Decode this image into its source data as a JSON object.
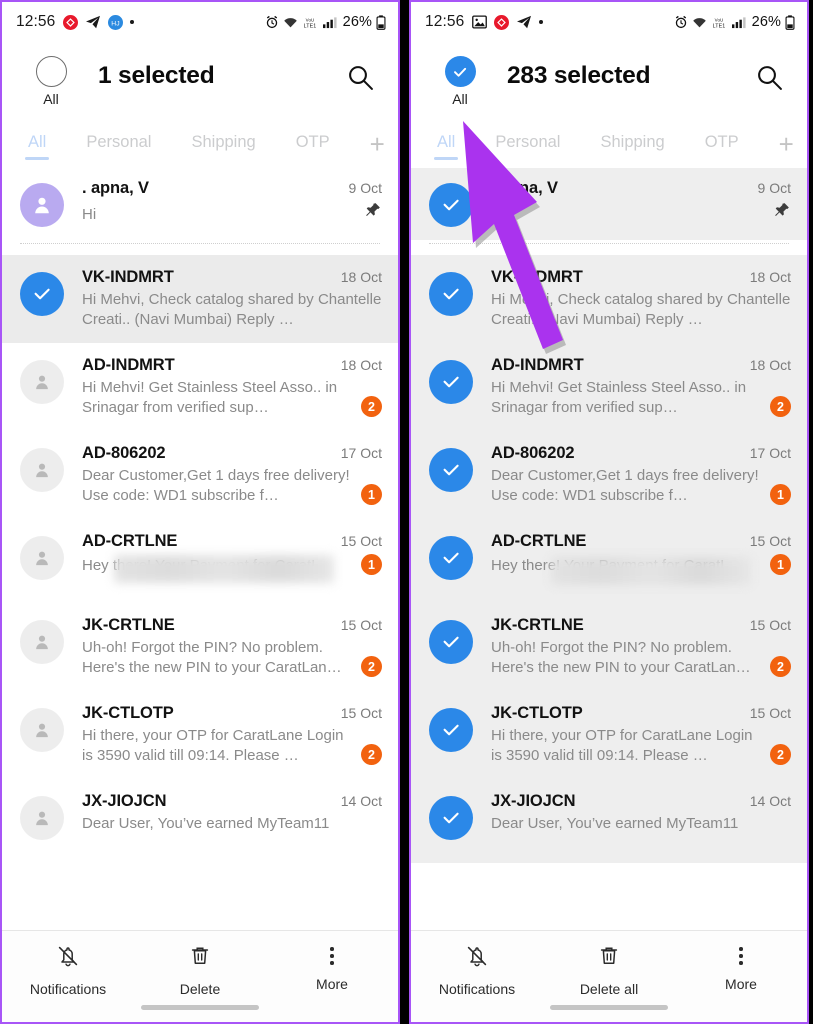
{
  "statusbar": {
    "time": "12:56",
    "battery_percent": "26%",
    "network_label": "LTE1",
    "voice_label": "VoLTE",
    "left_icons_panel1": [
      "telegram-icon",
      "blue-app-icon",
      "dot-icon"
    ],
    "left_icons_panel2": [
      "image-icon",
      "telegram-icon",
      "dot-icon"
    ],
    "right_icons": [
      "alarm-icon",
      "wifi-icon",
      "volte-icon",
      "signal-icon",
      "battery-icon"
    ]
  },
  "panels": [
    {
      "id": "before",
      "header": {
        "all_label": "All",
        "all_checked": false,
        "selected_text": "1 selected",
        "search_icon": "search-icon"
      },
      "tabs": [
        {
          "label": "All",
          "active": true
        },
        {
          "label": "Personal",
          "active": false
        },
        {
          "label": "Shipping",
          "active": false
        },
        {
          "label": "OTP",
          "active": false
        }
      ],
      "tab_add_label": "+",
      "bottombar": [
        {
          "label": "Notifications",
          "icon": "bell-off-icon"
        },
        {
          "label": "Delete",
          "icon": "trash-icon"
        },
        {
          "label": "More",
          "icon": "overflow-menu-icon"
        }
      ]
    },
    {
      "id": "after",
      "header": {
        "all_label": "All",
        "all_checked": true,
        "selected_text": "283 selected",
        "search_icon": "search-icon"
      },
      "tabs": [
        {
          "label": "All",
          "active": true
        },
        {
          "label": "Personal",
          "active": false
        },
        {
          "label": "Shipping",
          "active": false
        },
        {
          "label": "OTP",
          "active": false
        }
      ],
      "tab_add_label": "+",
      "bottombar": [
        {
          "label": "Notifications",
          "icon": "bell-off-icon"
        },
        {
          "label": "Delete all",
          "icon": "trash-icon"
        },
        {
          "label": "More",
          "icon": "overflow-menu-icon"
        }
      ]
    }
  ],
  "messages": [
    {
      "sender": ". apna, V",
      "date": "9 Oct",
      "snippet": "Hi",
      "badge": "",
      "pinned": true,
      "avatar": "purple",
      "selected_left": false,
      "selected_right": true,
      "highlight_left": false
    },
    {
      "sender": "VK-INDMRT",
      "date": "18 Oct",
      "snippet": "Hi Mehvi, Check catalog shared by Chantelle Creati.. (Navi Mumbai)  Reply …",
      "badge": "",
      "pinned": false,
      "avatar": "gray",
      "selected_left": true,
      "selected_right": true,
      "highlight_left": true
    },
    {
      "sender": "AD-INDMRT",
      "date": "18 Oct",
      "snippet": "Hi Mehvi! Get Stainless Steel Asso.. in Srinagar from verified sup…",
      "badge": "2",
      "pinned": false,
      "avatar": "gray",
      "selected_left": false,
      "selected_right": true,
      "highlight_left": false
    },
    {
      "sender": "AD-806202",
      "date": "17 Oct",
      "snippet": "Dear Customer,Get 1 days free delivery! Use code: WD1 subscribe f…",
      "badge": "1",
      "pinned": false,
      "avatar": "gray",
      "selected_left": false,
      "selected_right": true,
      "highlight_left": false
    },
    {
      "sender": "AD-CRTLNE",
      "date": "15 Oct",
      "snippet": "Hey there! Your Payment for CaratL",
      "snippet_redacted": true,
      "badge": "1",
      "pinned": false,
      "avatar": "gray",
      "selected_left": false,
      "selected_right": true,
      "highlight_left": false
    },
    {
      "sender": "JK-CRTLNE",
      "date": "15 Oct",
      "snippet": "Uh-oh! Forgot the PIN? No problem. Here's the new PIN to your CaratLan…",
      "badge": "2",
      "pinned": false,
      "avatar": "gray",
      "selected_left": false,
      "selected_right": true,
      "highlight_left": false
    },
    {
      "sender": "JK-CTLOTP",
      "date": "15 Oct",
      "snippet": "Hi there, your OTP for CaratLane Login is 3590 valid till 09:14. Please …",
      "badge": "2",
      "pinned": false,
      "avatar": "gray",
      "selected_left": false,
      "selected_right": true,
      "highlight_left": false
    },
    {
      "sender": "JX-JIOJCN",
      "date": "14 Oct",
      "snippet": "Dear User,  You’ve earned MyTeam11",
      "badge": "",
      "pinned": false,
      "avatar": "gray",
      "selected_left": false,
      "selected_right": true,
      "highlight_left": false
    }
  ],
  "annotation": {
    "arrow_color": "#aa33ee",
    "arrow_shadow": "#8a8a8a",
    "points_to": "all-select-toggle"
  },
  "colors": {
    "accent_blue": "#2b88e8",
    "badge_orange": "#f2620f",
    "avatar_purple": "#b9aaf0",
    "highlight_gray": "#ebebeb",
    "panel_border_purple": "#a855f7"
  }
}
